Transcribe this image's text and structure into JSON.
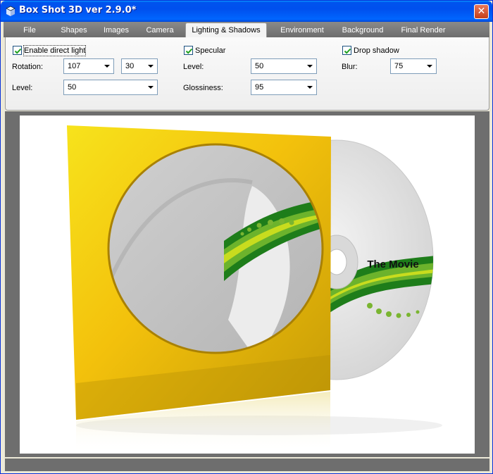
{
  "window": {
    "title": "Box Shot 3D ver 2.9.0*",
    "close_label": "✕"
  },
  "tabs": [
    {
      "label": "File",
      "active": false
    },
    {
      "label": "Shapes",
      "active": false
    },
    {
      "label": "Images",
      "active": false
    },
    {
      "label": "Camera",
      "active": false
    },
    {
      "label": "Lighting & Shadows",
      "active": true
    },
    {
      "label": "Environment",
      "active": false
    },
    {
      "label": "Background",
      "active": false
    },
    {
      "label": "Final Render",
      "active": false
    }
  ],
  "direct_light": {
    "enable_label": "Enable direct light",
    "enabled": true,
    "rotation_label": "Rotation:",
    "rotation_a": "107",
    "rotation_b": "30",
    "level_label": "Level:",
    "level": "50"
  },
  "specular": {
    "enable_label": "Specular",
    "enabled": true,
    "level_label": "Level:",
    "level": "50",
    "glossiness_label": "Glossiness:",
    "glossiness": "95"
  },
  "shadow": {
    "enable_label": "Drop shadow",
    "enabled": true,
    "blur_label": "Blur:",
    "blur": "75"
  },
  "preview": {
    "disc_title": "The Movie",
    "sleeve_color": "#f2c40c",
    "disc_color": "#e6e6e6",
    "stripe_colors": [
      "#1e7d1a",
      "#6cb32c",
      "#c8dc1e"
    ]
  }
}
